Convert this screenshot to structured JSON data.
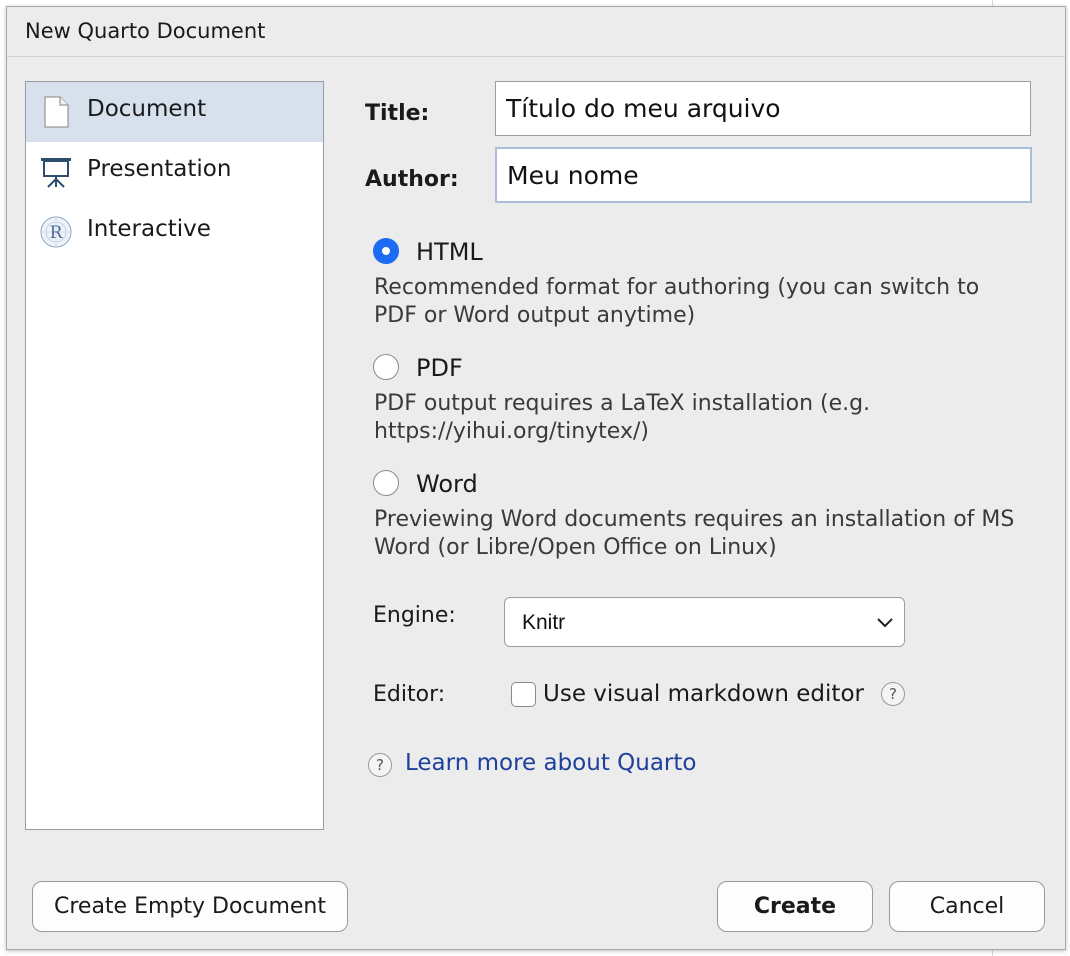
{
  "dialog": {
    "title": "New Quarto Document"
  },
  "sidebar": {
    "items": [
      {
        "label": "Document",
        "icon": "document-icon",
        "selected": true
      },
      {
        "label": "Presentation",
        "icon": "presentation-icon",
        "selected": false
      },
      {
        "label": "Interactive",
        "icon": "r-interactive-icon",
        "selected": false
      }
    ]
  },
  "form": {
    "title_label": "Title:",
    "title_value": "Título do meu arquivo",
    "author_label": "Author:",
    "author_value": "Meu nome"
  },
  "formats": [
    {
      "label": "HTML",
      "checked": true,
      "description": "Recommended format for authoring (you can switch to PDF or Word output anytime)"
    },
    {
      "label": "PDF",
      "checked": false,
      "description": "PDF output requires a LaTeX installation (e.g. https://yihui.org/tinytex/)"
    },
    {
      "label": "Word",
      "checked": false,
      "description": "Previewing Word documents requires an installation of MS Word (or Libre/Open Office on Linux)"
    }
  ],
  "engine": {
    "label": "Engine:",
    "selected": "Knitr"
  },
  "editor": {
    "label": "Editor:",
    "checkbox_label": "Use visual markdown editor",
    "checked": false
  },
  "learn_more": {
    "text": "Learn more about Quarto"
  },
  "buttons": {
    "create_empty": "Create Empty Document",
    "create": "Create",
    "cancel": "Cancel"
  },
  "colors": {
    "accent": "#1e6cf5",
    "selection": "#d6e1ed",
    "link": "#1f3f9c",
    "dialog_bg": "#ececec"
  }
}
